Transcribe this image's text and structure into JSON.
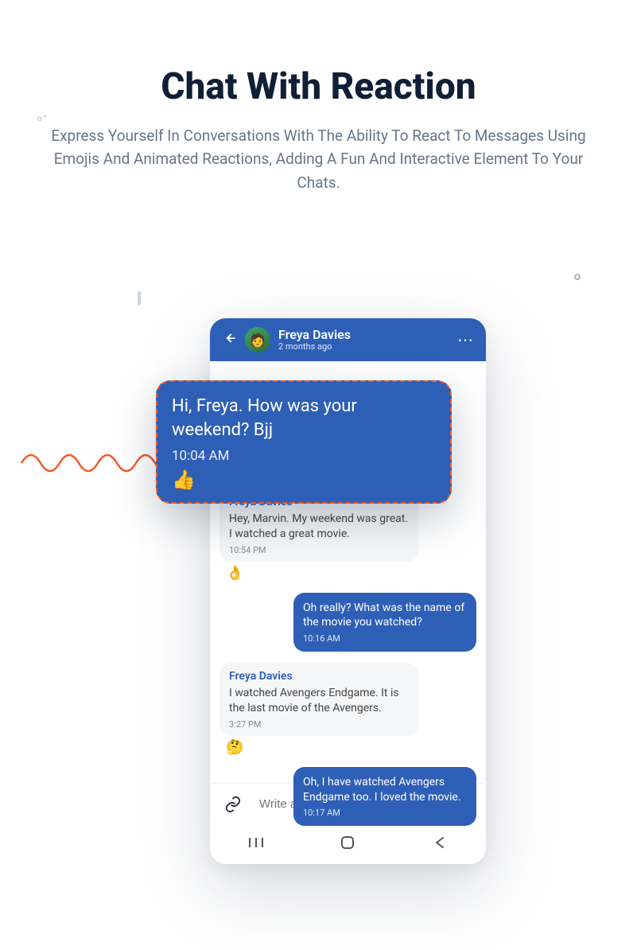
{
  "page": {
    "title": "Chat With Reaction",
    "subtitle": "Express Yourself In Conversations With The Ability To React To Messages Using Emojis And Animated Reactions, Adding A Fun And Interactive Element To Your Chats."
  },
  "chat": {
    "contact_name": "Freya Davies",
    "last_seen": "2 months ago"
  },
  "highlight": {
    "text": "Hi, Freya. How was your weekend? Bjj",
    "time": "10:04 AM",
    "reaction": "👍"
  },
  "messages": [
    {
      "side": "recv",
      "sender": "Freya Davies",
      "text": "Hey, Marvin. My weekend was great. I watched a great movie.",
      "time": "10:54 PM",
      "reaction": "👌"
    },
    {
      "side": "sent",
      "text": "Oh really? What was the name of the movie you watched?",
      "time": "10:16 AM"
    },
    {
      "side": "recv",
      "sender": "Freya Davies",
      "text": "I watched Avengers Endgame. It is the last movie of the Avengers.",
      "time": "3:27 PM",
      "reaction": "🤔"
    },
    {
      "side": "sent",
      "text": "Oh, I have watched Avengers Endgame too. I loved the movie.",
      "time": "10:17 AM"
    }
  ],
  "composer": {
    "placeholder": "Write a message"
  }
}
